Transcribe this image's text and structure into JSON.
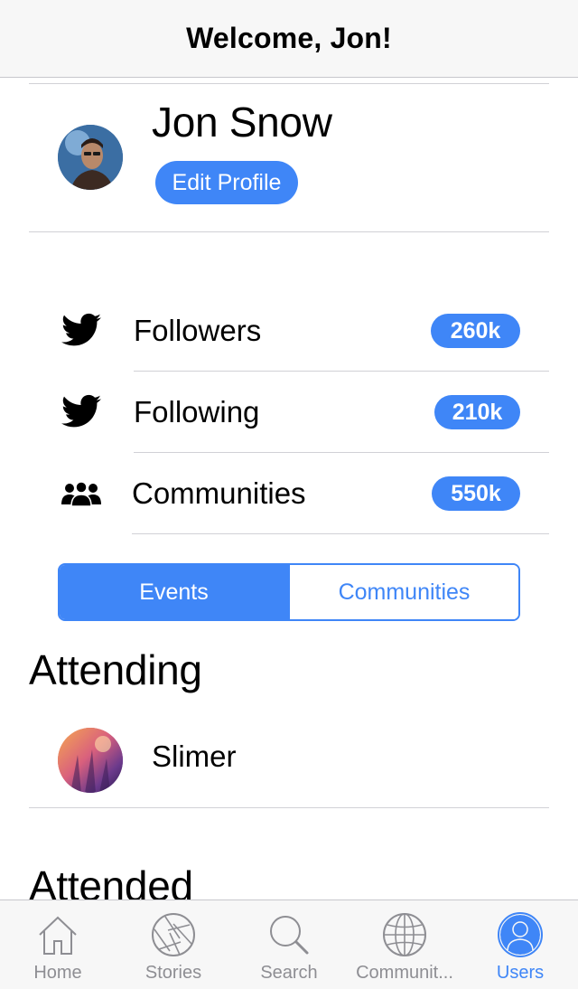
{
  "navbar": {
    "title": "Welcome, Jon!"
  },
  "profile": {
    "name": "Jon Snow",
    "edit_label": "Edit Profile"
  },
  "stats": [
    {
      "icon": "twitter-bird-icon",
      "label": "Followers",
      "value": "260k"
    },
    {
      "icon": "twitter-bird-icon",
      "label": "Following",
      "value": "210k"
    },
    {
      "icon": "group-people-icon",
      "label": "Communities",
      "value": "550k"
    }
  ],
  "segmented": {
    "options": [
      "Events",
      "Communities"
    ],
    "selected": "Events"
  },
  "sections": {
    "attending": "Attending",
    "attended": "Attended"
  },
  "events": [
    {
      "name": "Slimer"
    }
  ],
  "tabbar": {
    "items": [
      {
        "label": "Home",
        "icon": "home-icon"
      },
      {
        "label": "Stories",
        "icon": "aperture-icon"
      },
      {
        "label": "Search",
        "icon": "search-icon"
      },
      {
        "label": "Communit...",
        "icon": "globe-icon"
      },
      {
        "label": "Users",
        "icon": "user-icon"
      }
    ],
    "selected": "Users"
  },
  "colors": {
    "accent": "#3f86f7",
    "inactive": "#8e8e93",
    "bar_background": "#f7f7f7",
    "separator": "#d1d1d6"
  }
}
